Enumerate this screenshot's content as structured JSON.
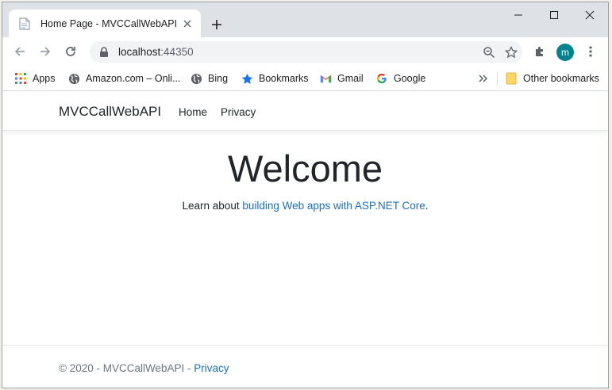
{
  "tab": {
    "title": "Home Page - MVCCallWebAPI"
  },
  "address_bar": {
    "host": "localhost",
    "port": ":44350"
  },
  "profile": {
    "initial": "m",
    "color": "#00838f"
  },
  "bookmarks": {
    "items": [
      {
        "label": "Apps",
        "icon": "apps-grid-icon"
      },
      {
        "label": "Amazon.com – Onli...",
        "icon": "globe-icon"
      },
      {
        "label": "Bing",
        "icon": "globe-icon"
      },
      {
        "label": "Bookmarks",
        "icon": "star-icon"
      },
      {
        "label": "Gmail",
        "icon": "gmail-icon"
      },
      {
        "label": "Google",
        "icon": "google-icon"
      }
    ],
    "other": "Other bookmarks"
  },
  "site": {
    "brand": "MVCCallWebAPI",
    "nav": {
      "home": "Home",
      "privacy": "Privacy"
    },
    "heading": "Welcome",
    "learn_prefix": "Learn about ",
    "learn_link": "building Web apps with ASP.NET Core",
    "learn_suffix": ".",
    "footer_text": "© 2020 - MVCCallWebAPI - ",
    "footer_link": "Privacy",
    "link_color": "#1b6ec2"
  }
}
